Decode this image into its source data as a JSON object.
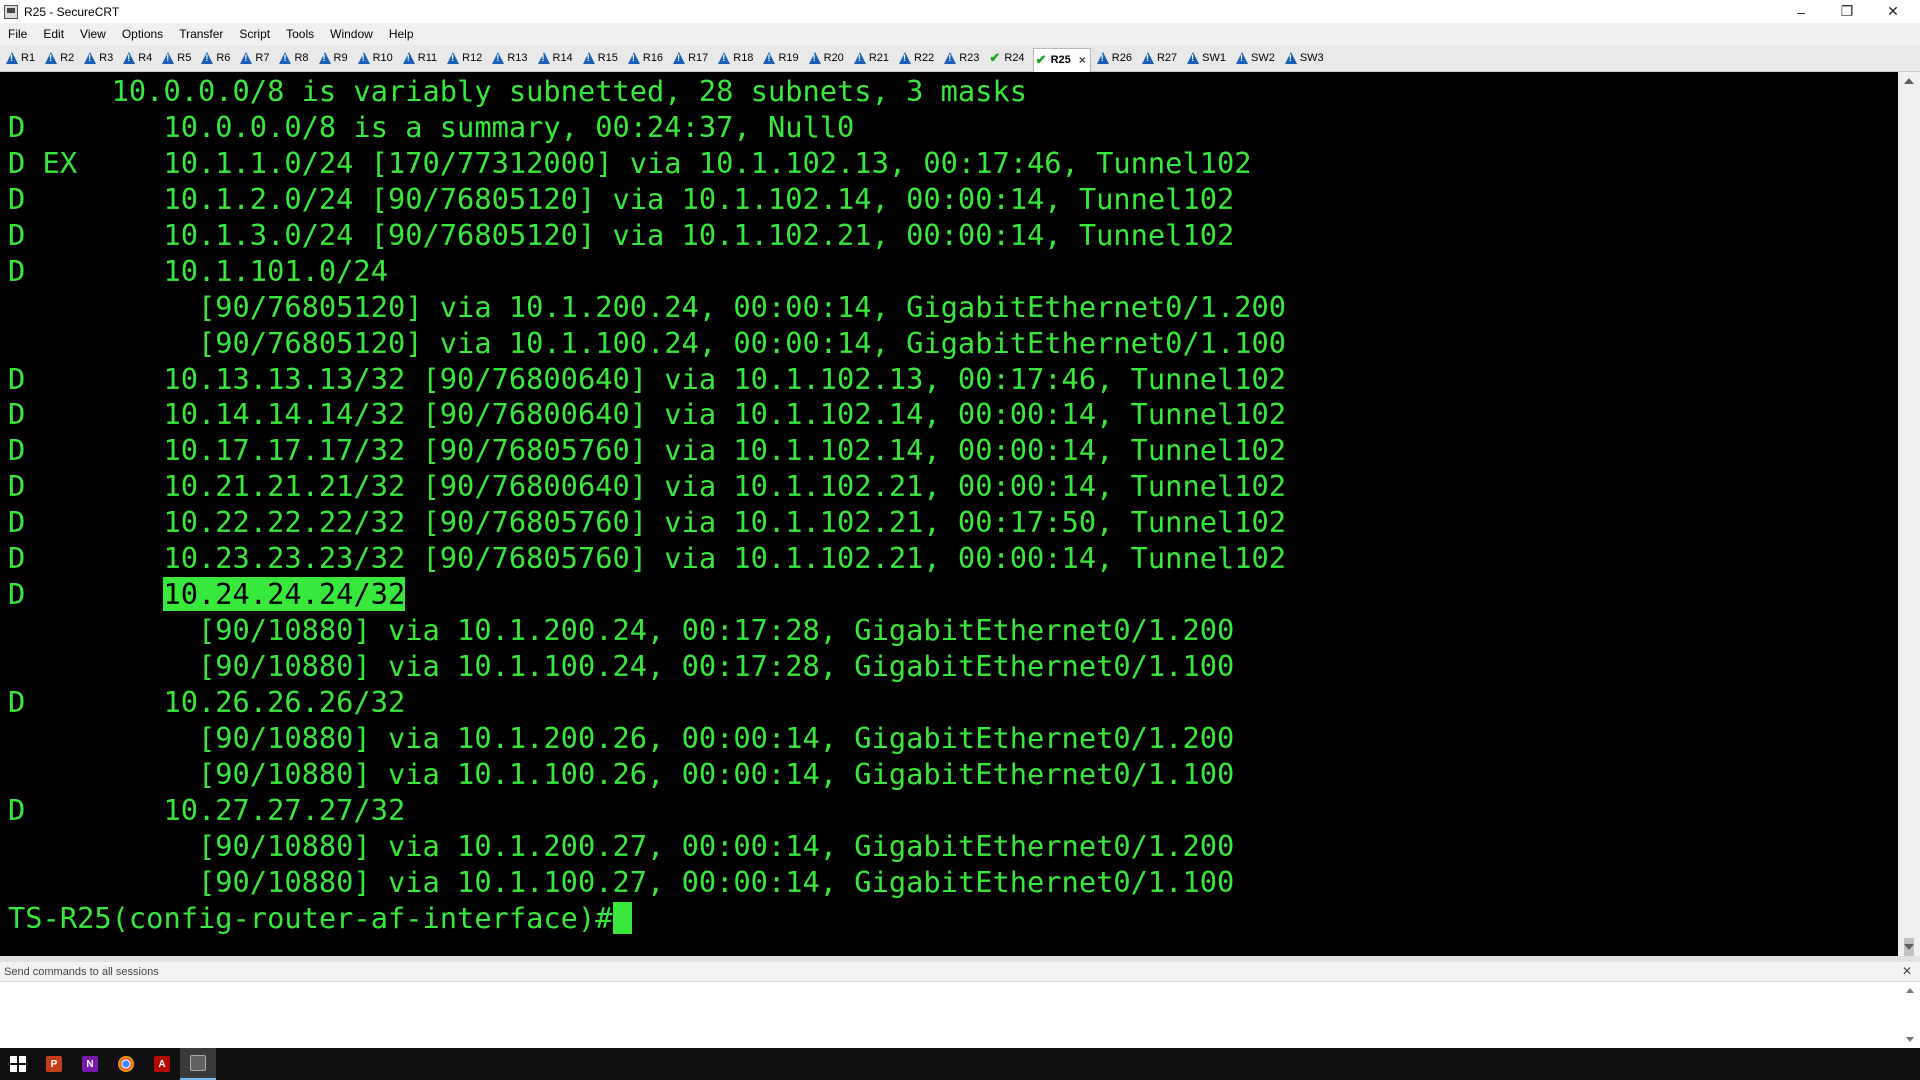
{
  "window": {
    "title": "R25 - SecureCRT",
    "minimize": "–",
    "restore": "❐",
    "close": "✕"
  },
  "menu": [
    "File",
    "Edit",
    "View",
    "Options",
    "Transfer",
    "Script",
    "Tools",
    "Window",
    "Help"
  ],
  "tabs": [
    {
      "label": "R1",
      "status": "warn"
    },
    {
      "label": "R2",
      "status": "warn"
    },
    {
      "label": "R3",
      "status": "warn"
    },
    {
      "label": "R4",
      "status": "warn"
    },
    {
      "label": "R5",
      "status": "warn"
    },
    {
      "label": "R6",
      "status": "warn"
    },
    {
      "label": "R7",
      "status": "warn"
    },
    {
      "label": "R8",
      "status": "warn"
    },
    {
      "label": "R9",
      "status": "warn"
    },
    {
      "label": "R10",
      "status": "warn"
    },
    {
      "label": "R11",
      "status": "warn"
    },
    {
      "label": "R12",
      "status": "warn"
    },
    {
      "label": "R13",
      "status": "warn"
    },
    {
      "label": "R14",
      "status": "warn"
    },
    {
      "label": "R15",
      "status": "warn"
    },
    {
      "label": "R16",
      "status": "warn"
    },
    {
      "label": "R17",
      "status": "warn"
    },
    {
      "label": "R18",
      "status": "warn"
    },
    {
      "label": "R19",
      "status": "warn"
    },
    {
      "label": "R20",
      "status": "warn"
    },
    {
      "label": "R21",
      "status": "warn"
    },
    {
      "label": "R22",
      "status": "warn"
    },
    {
      "label": "R23",
      "status": "warn"
    },
    {
      "label": "R24",
      "status": "ok"
    },
    {
      "label": "R25",
      "status": "ok",
      "active": true
    },
    {
      "label": "R26",
      "status": "warn"
    },
    {
      "label": "R27",
      "status": "warn"
    },
    {
      "label": "SW1",
      "status": "warn"
    },
    {
      "label": "SW2",
      "status": "warn"
    },
    {
      "label": "SW3",
      "status": "warn"
    }
  ],
  "tab_close": "×",
  "terminal": {
    "lines": [
      "      10.0.0.0/8 is variably subnetted, 28 subnets, 3 masks",
      "D        10.0.0.0/8 is a summary, 00:24:37, Null0",
      "D EX     10.1.1.0/24 [170/77312000] via 10.1.102.13, 00:17:46, Tunnel102",
      "D        10.1.2.0/24 [90/76805120] via 10.1.102.14, 00:00:14, Tunnel102",
      "D        10.1.3.0/24 [90/76805120] via 10.1.102.21, 00:00:14, Tunnel102",
      "D        10.1.101.0/24",
      "           [90/76805120] via 10.1.200.24, 00:00:14, GigabitEthernet0/1.200",
      "           [90/76805120] via 10.1.100.24, 00:00:14, GigabitEthernet0/1.100",
      "D        10.13.13.13/32 [90/76800640] via 10.1.102.13, 00:17:46, Tunnel102",
      "D        10.14.14.14/32 [90/76800640] via 10.1.102.14, 00:00:14, Tunnel102",
      "D        10.17.17.17/32 [90/76805760] via 10.1.102.14, 00:00:14, Tunnel102",
      "D        10.21.21.21/32 [90/76800640] via 10.1.102.21, 00:00:14, Tunnel102",
      "D        10.22.22.22/32 [90/76805760] via 10.1.102.21, 00:17:50, Tunnel102",
      "D        10.23.23.23/32 [90/76805760] via 10.1.102.21, 00:00:14, Tunnel102",
      "",
      "           [90/10880] via 10.1.200.24, 00:17:28, GigabitEthernet0/1.200",
      "           [90/10880] via 10.1.100.24, 00:17:28, GigabitEthernet0/1.100",
      "D        10.26.26.26/32",
      "           [90/10880] via 10.1.200.26, 00:00:14, GigabitEthernet0/1.200",
      "           [90/10880] via 10.1.100.26, 00:00:14, GigabitEthernet0/1.100",
      "D        10.27.27.27/32",
      "           [90/10880] via 10.1.200.27, 00:00:14, GigabitEthernet0/1.200",
      "           [90/10880] via 10.1.100.27, 00:00:14, GigabitEthernet0/1.100"
    ],
    "highlight_prefix": "D        ",
    "highlight_text": "10.24.24.24/32",
    "prompt": "TS-R25(config-router-af-interface)#"
  },
  "send_bar": {
    "label": "Send commands to all sessions",
    "close": "✕"
  },
  "colors": {
    "terminal_fg": "#39e83c",
    "terminal_bg": "#000000"
  }
}
